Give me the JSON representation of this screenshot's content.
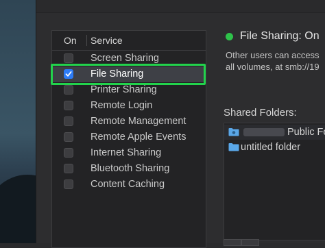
{
  "services_panel": {
    "header_on": "On",
    "header_service": "Service",
    "items": [
      {
        "label": "Screen Sharing",
        "checked": false,
        "selected": false
      },
      {
        "label": "File Sharing",
        "checked": true,
        "selected": true
      },
      {
        "label": "Printer Sharing",
        "checked": false,
        "selected": false
      },
      {
        "label": "Remote Login",
        "checked": false,
        "selected": false
      },
      {
        "label": "Remote Management",
        "checked": false,
        "selected": false
      },
      {
        "label": "Remote Apple Events",
        "checked": false,
        "selected": false
      },
      {
        "label": "Internet Sharing",
        "checked": false,
        "selected": false
      },
      {
        "label": "Bluetooth Sharing",
        "checked": false,
        "selected": false
      },
      {
        "label": "Content Caching",
        "checked": false,
        "selected": false
      }
    ]
  },
  "status": {
    "text": "File Sharing: On",
    "color": "#2ec24a",
    "description_line1": "Other users can access",
    "description_line2": "all volumes, at smb://19"
  },
  "shared_folders": {
    "label": "Shared Folders:",
    "folders": [
      {
        "name": "Public Fo",
        "icon": "shared-folder-icon"
      },
      {
        "name": "untitled folder",
        "icon": "folder-icon"
      }
    ]
  },
  "colors": {
    "highlight": "#22d34c",
    "checkbox_checked": "#2d7cf6",
    "folder": "#5aa7e8"
  }
}
